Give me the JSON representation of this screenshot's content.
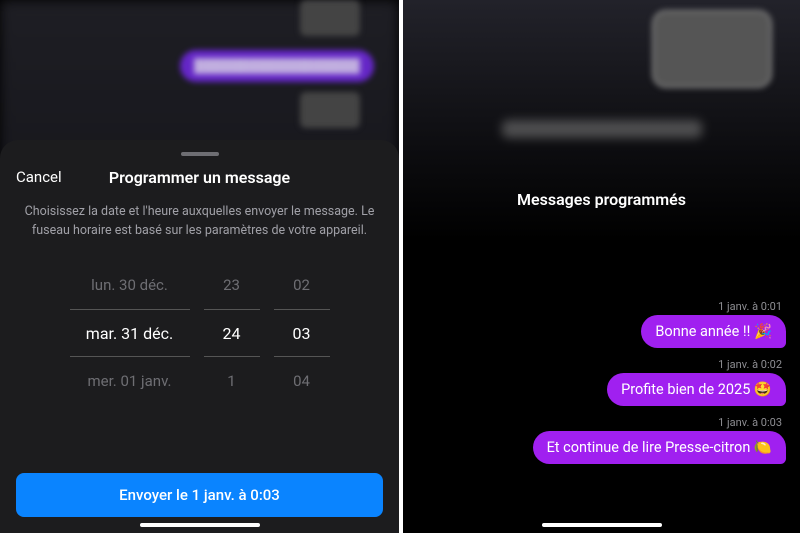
{
  "colors": {
    "accent_blue": "#0a84ff",
    "bubble_purple": "#a020f0",
    "sheet_bg": "#1c1c1e",
    "text_muted": "#6e6e73"
  },
  "left": {
    "cancel": "Cancel",
    "title": "Programmer un message",
    "description": "Choisissez la date et l'heure auxquelles envoyer le message. Le fuseau horaire est basé sur les paramètres de votre appareil.",
    "picker": {
      "date": {
        "prev": "lun. 30 déc.",
        "selected": "mar. 31 déc.",
        "next": "mer. 01 janv."
      },
      "hour": {
        "prev": "23",
        "selected": "24",
        "next": "1"
      },
      "minute": {
        "prev": "02",
        "selected": "03",
        "next": "04"
      }
    },
    "send_label": "Envoyer le 1 janv. à 0:03"
  },
  "right": {
    "title": "Messages programmés",
    "messages": [
      {
        "timestamp": "1 janv. à 0:01",
        "text": "Bonne année !! 🎉"
      },
      {
        "timestamp": "1 janv. à 0:02",
        "text": "Profite bien de 2025 🤩"
      },
      {
        "timestamp": "1 janv. à 0:03",
        "text": "Et continue de lire Presse-citron 🍋"
      }
    ]
  }
}
